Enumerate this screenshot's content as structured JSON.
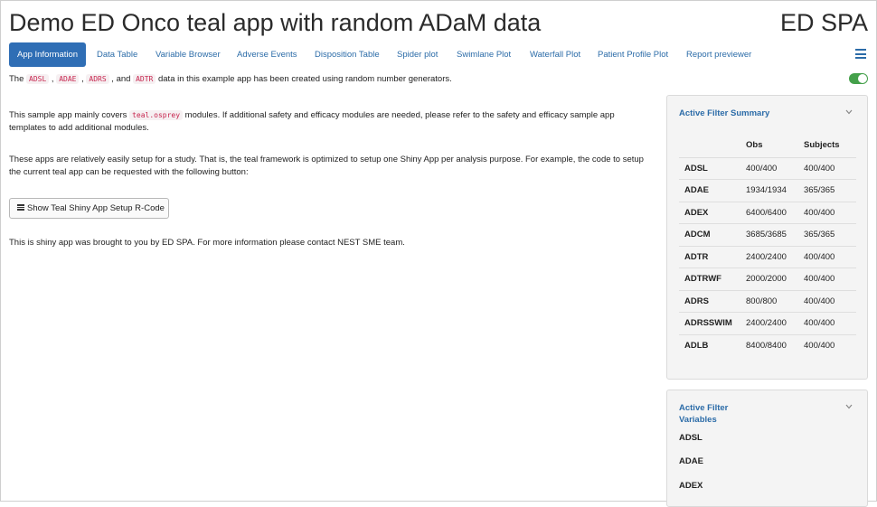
{
  "header": {
    "title": "Demo ED Onco teal app with random ADaM data",
    "brand": "ED SPA"
  },
  "tabs": [
    {
      "label": "App Information",
      "active": true
    },
    {
      "label": "Data Table"
    },
    {
      "label": "Variable Browser"
    },
    {
      "label": "Adverse Events"
    },
    {
      "label": "Disposition Table"
    },
    {
      "label": "Spider plot"
    },
    {
      "label": "Swimlane Plot"
    },
    {
      "label": "Waterfall Plot"
    },
    {
      "label": "Patient Profile Plot"
    },
    {
      "label": "Report previewer"
    }
  ],
  "icons": {
    "menu": "hamburger-menu-icon",
    "toggle": "toggle-switch",
    "chevron": "chevron-down-icon",
    "button_icon": "list-lines-icon"
  },
  "colors": {
    "accent": "#2f6eb5",
    "link": "#2c6ca8",
    "toggle_on": "#44a04a",
    "code": "#c7254e"
  },
  "main": {
    "intro": {
      "p1": "The ",
      "code1": "ADSL",
      "sep1": " , ",
      "code2": "ADAE",
      "sep2": " , ",
      "code3": "ADRS",
      "sep3": " , and ",
      "code4": "ADTR",
      "tail": " data in this example app has been created using random number generators."
    },
    "modules": {
      "pre": "This sample app mainly covers ",
      "code": "teal.osprey",
      "post": " modules. If additional safety and efficacy modules are needed, please refer to the safety and efficacy sample app templates to add additional modules."
    },
    "setup_text": "These apps are relatively easily setup for a study. That is, the teal framework is optimized to setup one Shiny App per analysis purpose. For example, the code to setup the current teal app can be requested with the following button:",
    "button_label": "Show Teal Shiny App Setup R-Code",
    "footer_text": "This is shiny app was brought to you by ED SPA. For more information please contact NEST SME team."
  },
  "filter_summary": {
    "title": "Active Filter Summary",
    "columns": [
      "",
      "Obs",
      "Subjects"
    ],
    "rows": [
      {
        "dataset": "ADSL",
        "obs": "400/400",
        "subjects": "400/400"
      },
      {
        "dataset": "ADAE",
        "obs": "1934/1934",
        "subjects": "365/365"
      },
      {
        "dataset": "ADEX",
        "obs": "6400/6400",
        "subjects": "400/400"
      },
      {
        "dataset": "ADCM",
        "obs": "3685/3685",
        "subjects": "365/365"
      },
      {
        "dataset": "ADTR",
        "obs": "2400/2400",
        "subjects": "400/400"
      },
      {
        "dataset": "ADTRWF",
        "obs": "2000/2000",
        "subjects": "400/400"
      },
      {
        "dataset": "ADRS",
        "obs": "800/800",
        "subjects": "400/400"
      },
      {
        "dataset": "ADRSSWIM",
        "obs": "2400/2400",
        "subjects": "400/400"
      },
      {
        "dataset": "ADLB",
        "obs": "8400/8400",
        "subjects": "400/400"
      }
    ]
  },
  "filter_variables": {
    "title_line1": "Active Filter",
    "title_line2": "Variables",
    "items": [
      "ADSL",
      "ADAE",
      "ADEX"
    ]
  }
}
